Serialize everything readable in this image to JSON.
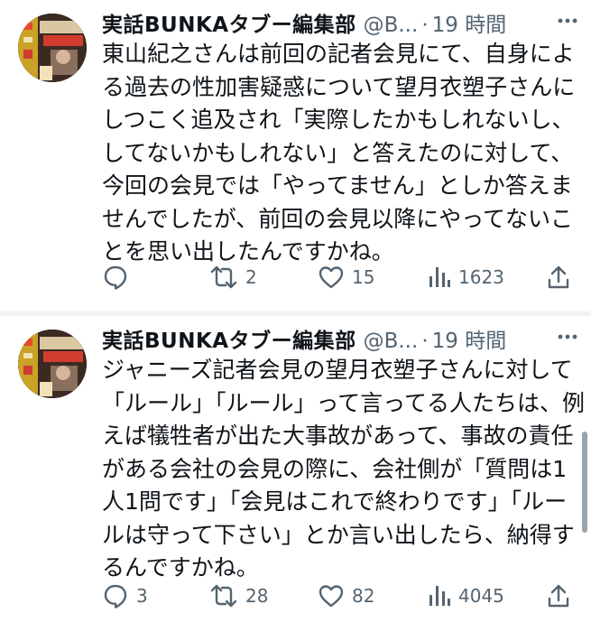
{
  "tweets": [
    {
      "author_name": "実話BUNKAタブー編集部",
      "handle": "@B...",
      "time": "19 時間",
      "text": "東山紀之さんは前回の記者会見にて、自身による過去の性加害疑惑について望月衣塑子さんにしつこく追及され「実際したかもしれないし、してないかもしれない」と答えたのに対して、今回の会見では「やってません」としか答えませんでしたが、前回の会見以降にやってないことを思い出したんですかね。",
      "reply_count": "",
      "retweet_count": "2",
      "like_count": "15",
      "view_count": "1623"
    },
    {
      "author_name": "実話BUNKAタブー編集部",
      "handle": "@B...",
      "time": "19 時間",
      "text": "ジャニーズ記者会見の望月衣塑子さんに対して「ルール」「ルール」って言ってる人たちは、例えば犠牲者が出た大事故があって、事故の責任がある会社の会見の際に、会社側が「質問は1人1問です」「会見はこれで終わりです」「ルールは守って下さい」とか言い出したら、納得するんですかね。",
      "reply_count": "3",
      "retweet_count": "28",
      "like_count": "82",
      "view_count": "4045"
    }
  ],
  "icons": {
    "avatar": "avatar-magazine-cover",
    "more": "more-options-icon",
    "reply": "reply-icon",
    "retweet": "retweet-icon",
    "like": "heart-icon",
    "views": "views-bar-chart-icon",
    "share": "share-icon"
  },
  "colors": {
    "text": "#0f1419",
    "secondary": "#536471",
    "separator": "#eff3f4"
  }
}
